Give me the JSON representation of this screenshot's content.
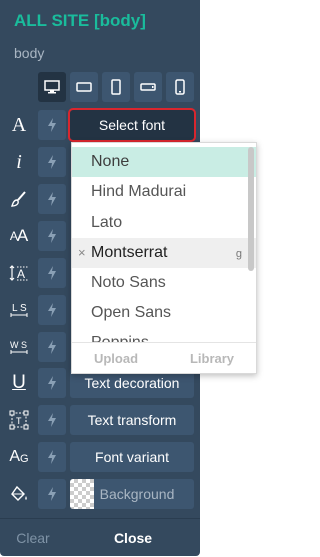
{
  "panel": {
    "title": "ALL SITE [body]",
    "subtitle": "body"
  },
  "devices": [
    {
      "name": "desktop",
      "icon": "desktop-icon",
      "active": true
    },
    {
      "name": "tablet-landscape",
      "icon": "tablet-landscape-icon",
      "active": false
    },
    {
      "name": "tablet-portrait",
      "icon": "tablet-portrait-icon",
      "active": false
    },
    {
      "name": "phone-landscape",
      "icon": "phone-landscape-icon",
      "active": false
    },
    {
      "name": "phone-portrait",
      "icon": "phone-portrait-icon",
      "active": false
    }
  ],
  "rows": {
    "font_family": "Select font",
    "text_decoration": "Text decoration",
    "text_transform": "Text transform",
    "font_variant": "Font variant",
    "background": "Background"
  },
  "font_dropdown": {
    "options": [
      "None",
      "Hind Madurai",
      "Lato",
      "Montserrat",
      "Noto Sans",
      "Open Sans",
      "Poppins"
    ],
    "highlighted": "None",
    "hovered": "Montserrat",
    "hovered_badge": "g",
    "remove_glyph": "×",
    "upload_label": "Upload",
    "library_label": "Library"
  },
  "footer": {
    "clear_label": "Clear",
    "close_label": "Close"
  },
  "colors": {
    "panel": "#34495e",
    "accent": "#1abc9c",
    "selected_border": "#d9262e",
    "option_highlight": "#c9ede4"
  }
}
